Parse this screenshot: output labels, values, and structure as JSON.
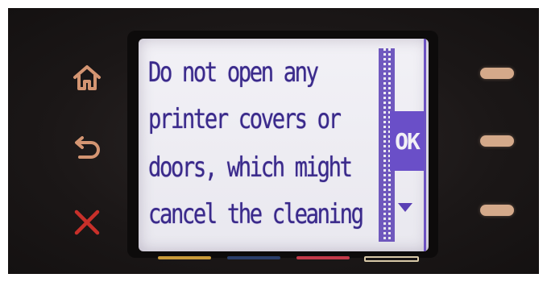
{
  "screen": {
    "message_lines": [
      "Do not open any",
      "printer covers or",
      "doors, which might",
      "cancel the cleaning"
    ],
    "ok_label": "OK",
    "scroll_down_icon": "down-triangle-icon"
  },
  "left_buttons": {
    "home_icon": "home-icon",
    "back_icon": "back-arrow-icon",
    "cancel_icon": "cancel-x-icon"
  },
  "colors": {
    "screen_text": "#3a2a8a",
    "screen_accent": "#6a4fc8",
    "home_back_icon": "#d49572",
    "cancel_icon": "#c8302a",
    "side_pill": "#d4a98a"
  },
  "bottom_indicators": [
    "#c99a3a",
    "#2a3e6a",
    "#c33a4a",
    "#d8c9a8"
  ]
}
